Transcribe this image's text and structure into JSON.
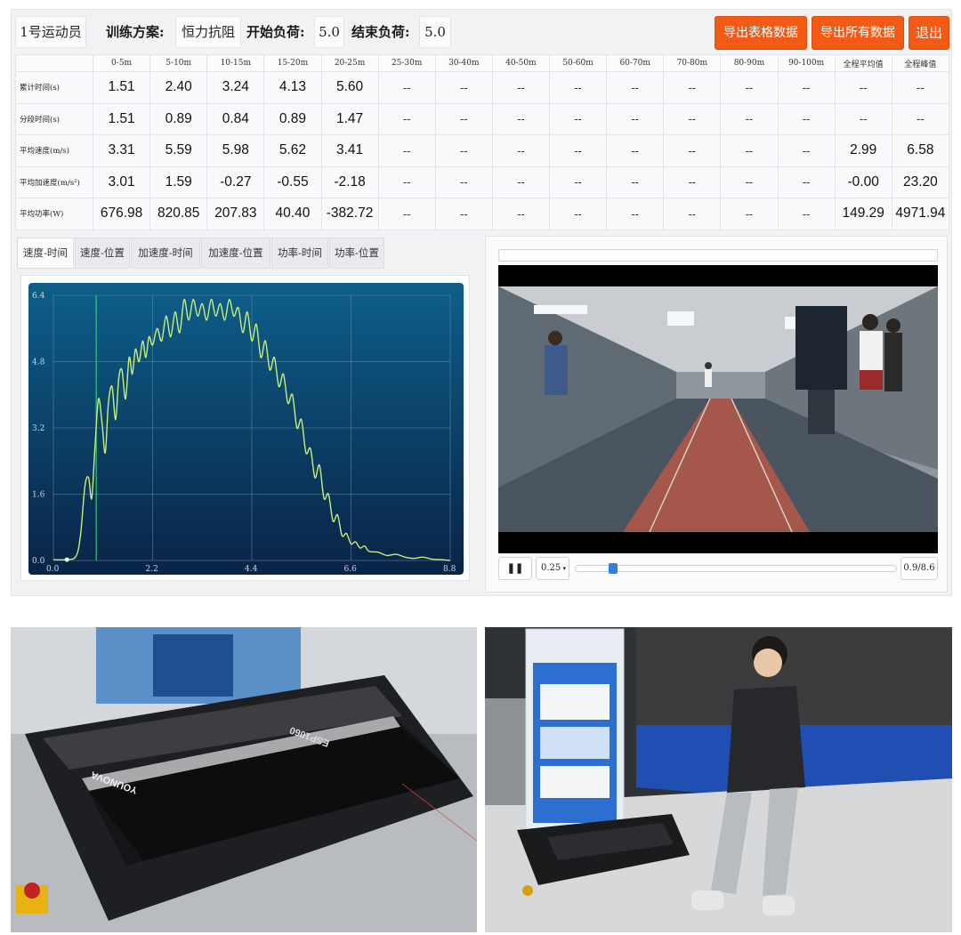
{
  "header": {
    "athlete": "1号运动员",
    "plan_label": "训练方案:",
    "plan_value": "恒力抗阻",
    "start_label": "开始负荷:",
    "start_value": "5.0",
    "end_label": "结束负荷:",
    "end_value": "5.0",
    "export_table_label": "导出表格数据",
    "export_all_label": "导出所有数据",
    "exit_label": "退出"
  },
  "table": {
    "columns": [
      "0-5m",
      "5-10m",
      "10-15m",
      "15-20m",
      "20-25m",
      "25-30m",
      "30-40m",
      "40-50m",
      "50-60m",
      "60-70m",
      "70-80m",
      "80-90m",
      "90-100m",
      "全程平均值",
      "全程峰值"
    ],
    "rows": [
      {
        "label": "累计时间(s)",
        "cells": [
          "1.51",
          "2.40",
          "3.24",
          "4.13",
          "5.60",
          "--",
          "--",
          "--",
          "--",
          "--",
          "--",
          "--",
          "--",
          "--",
          "--"
        ]
      },
      {
        "label": "分段时间(s)",
        "cells": [
          "1.51",
          "0.89",
          "0.84",
          "0.89",
          "1.47",
          "--",
          "--",
          "--",
          "--",
          "--",
          "--",
          "--",
          "--",
          "--",
          "--"
        ]
      },
      {
        "label": "平均速度(m/s)",
        "cells": [
          "3.31",
          "5.59",
          "5.98",
          "5.62",
          "3.41",
          "--",
          "--",
          "--",
          "--",
          "--",
          "--",
          "--",
          "--",
          "2.99",
          "6.58"
        ]
      },
      {
        "label": "平均加速度(m/s²)",
        "cells": [
          "3.01",
          "1.59",
          "-0.27",
          "-0.55",
          "-2.18",
          "--",
          "--",
          "--",
          "--",
          "--",
          "--",
          "--",
          "--",
          "-0.00",
          "23.20"
        ]
      },
      {
        "label": "平均功率(W)",
        "cells": [
          "676.98",
          "820.85",
          "207.83",
          "40.40",
          "-382.72",
          "--",
          "--",
          "--",
          "--",
          "--",
          "--",
          "--",
          "--",
          "149.29",
          "4971.94"
        ]
      }
    ]
  },
  "tabs": [
    "速度-时间",
    "速度-位置",
    "加速度-时间",
    "加速度-位置",
    "功率-时间",
    "功率-位置"
  ],
  "chart_data": {
    "type": "line",
    "xlim": [
      0,
      8.8
    ],
    "ylim": [
      0,
      6.4
    ],
    "xticks": [
      "0.0",
      "2.2",
      "4.4",
      "6.6",
      "8.8"
    ],
    "yticks": [
      "0.0",
      "1.6",
      "3.2",
      "4.8",
      "6.4"
    ],
    "marker_x": 0.95,
    "x": [
      0,
      0.3,
      0.5,
      0.6,
      0.7,
      0.78,
      0.85,
      0.92,
      1.0,
      1.08,
      1.15,
      1.22,
      1.3,
      1.38,
      1.45,
      1.52,
      1.6,
      1.68,
      1.75,
      1.82,
      1.9,
      1.98,
      2.05,
      2.12,
      2.2,
      2.3,
      2.4,
      2.5,
      2.6,
      2.7,
      2.8,
      2.9,
      3.0,
      3.1,
      3.2,
      3.3,
      3.4,
      3.5,
      3.6,
      3.7,
      3.8,
      3.9,
      4.0,
      4.1,
      4.2,
      4.3,
      4.4,
      4.5,
      4.6,
      4.7,
      4.8,
      4.9,
      5.0,
      5.1,
      5.2,
      5.3,
      5.4,
      5.5,
      5.6,
      5.7,
      5.8,
      5.9,
      6.0,
      6.1,
      6.2,
      6.3,
      6.4,
      6.5,
      6.6,
      6.7,
      6.8,
      6.9,
      7.0,
      7.2,
      7.4,
      7.6,
      7.8,
      8.0,
      8.2,
      8.4,
      8.6,
      8.8
    ],
    "y": [
      0.02,
      0.02,
      0.1,
      0.6,
      1.8,
      2.0,
      1.5,
      2.7,
      3.9,
      3.3,
      2.6,
      3.8,
      4.2,
      3.4,
      4.4,
      4.6,
      3.9,
      4.9,
      4.5,
      5.1,
      4.8,
      5.3,
      4.9,
      5.4,
      5.2,
      5.6,
      5.3,
      5.9,
      5.4,
      6.0,
      5.5,
      6.3,
      5.8,
      6.3,
      5.9,
      6.2,
      5.8,
      6.3,
      5.9,
      6.2,
      5.8,
      6.3,
      5.9,
      6.1,
      5.5,
      6.0,
      5.3,
      5.7,
      4.9,
      5.3,
      4.6,
      4.9,
      4.2,
      4.5,
      3.8,
      4.0,
      3.2,
      3.4,
      2.6,
      2.7,
      2.0,
      2.3,
      1.5,
      1.6,
      0.95,
      1.1,
      0.6,
      0.65,
      0.4,
      0.45,
      0.3,
      0.35,
      0.22,
      0.2,
      0.12,
      0.15,
      0.08,
      0.05,
      0.08,
      0.03,
      0.02,
      0.0
    ]
  },
  "video": {
    "speed": "0.25",
    "time": "0.9/8.6",
    "progress": 0.105
  },
  "photos": {
    "device_label": "ESP1060",
    "brand": "YOUNOVA"
  },
  "colors": {
    "accent": "#f25a16",
    "chart_bg_top": "#0d5f8a",
    "chart_bg_bottom": "#0a2346",
    "curve": "#c9ee7a",
    "marker": "#2ecc71"
  }
}
